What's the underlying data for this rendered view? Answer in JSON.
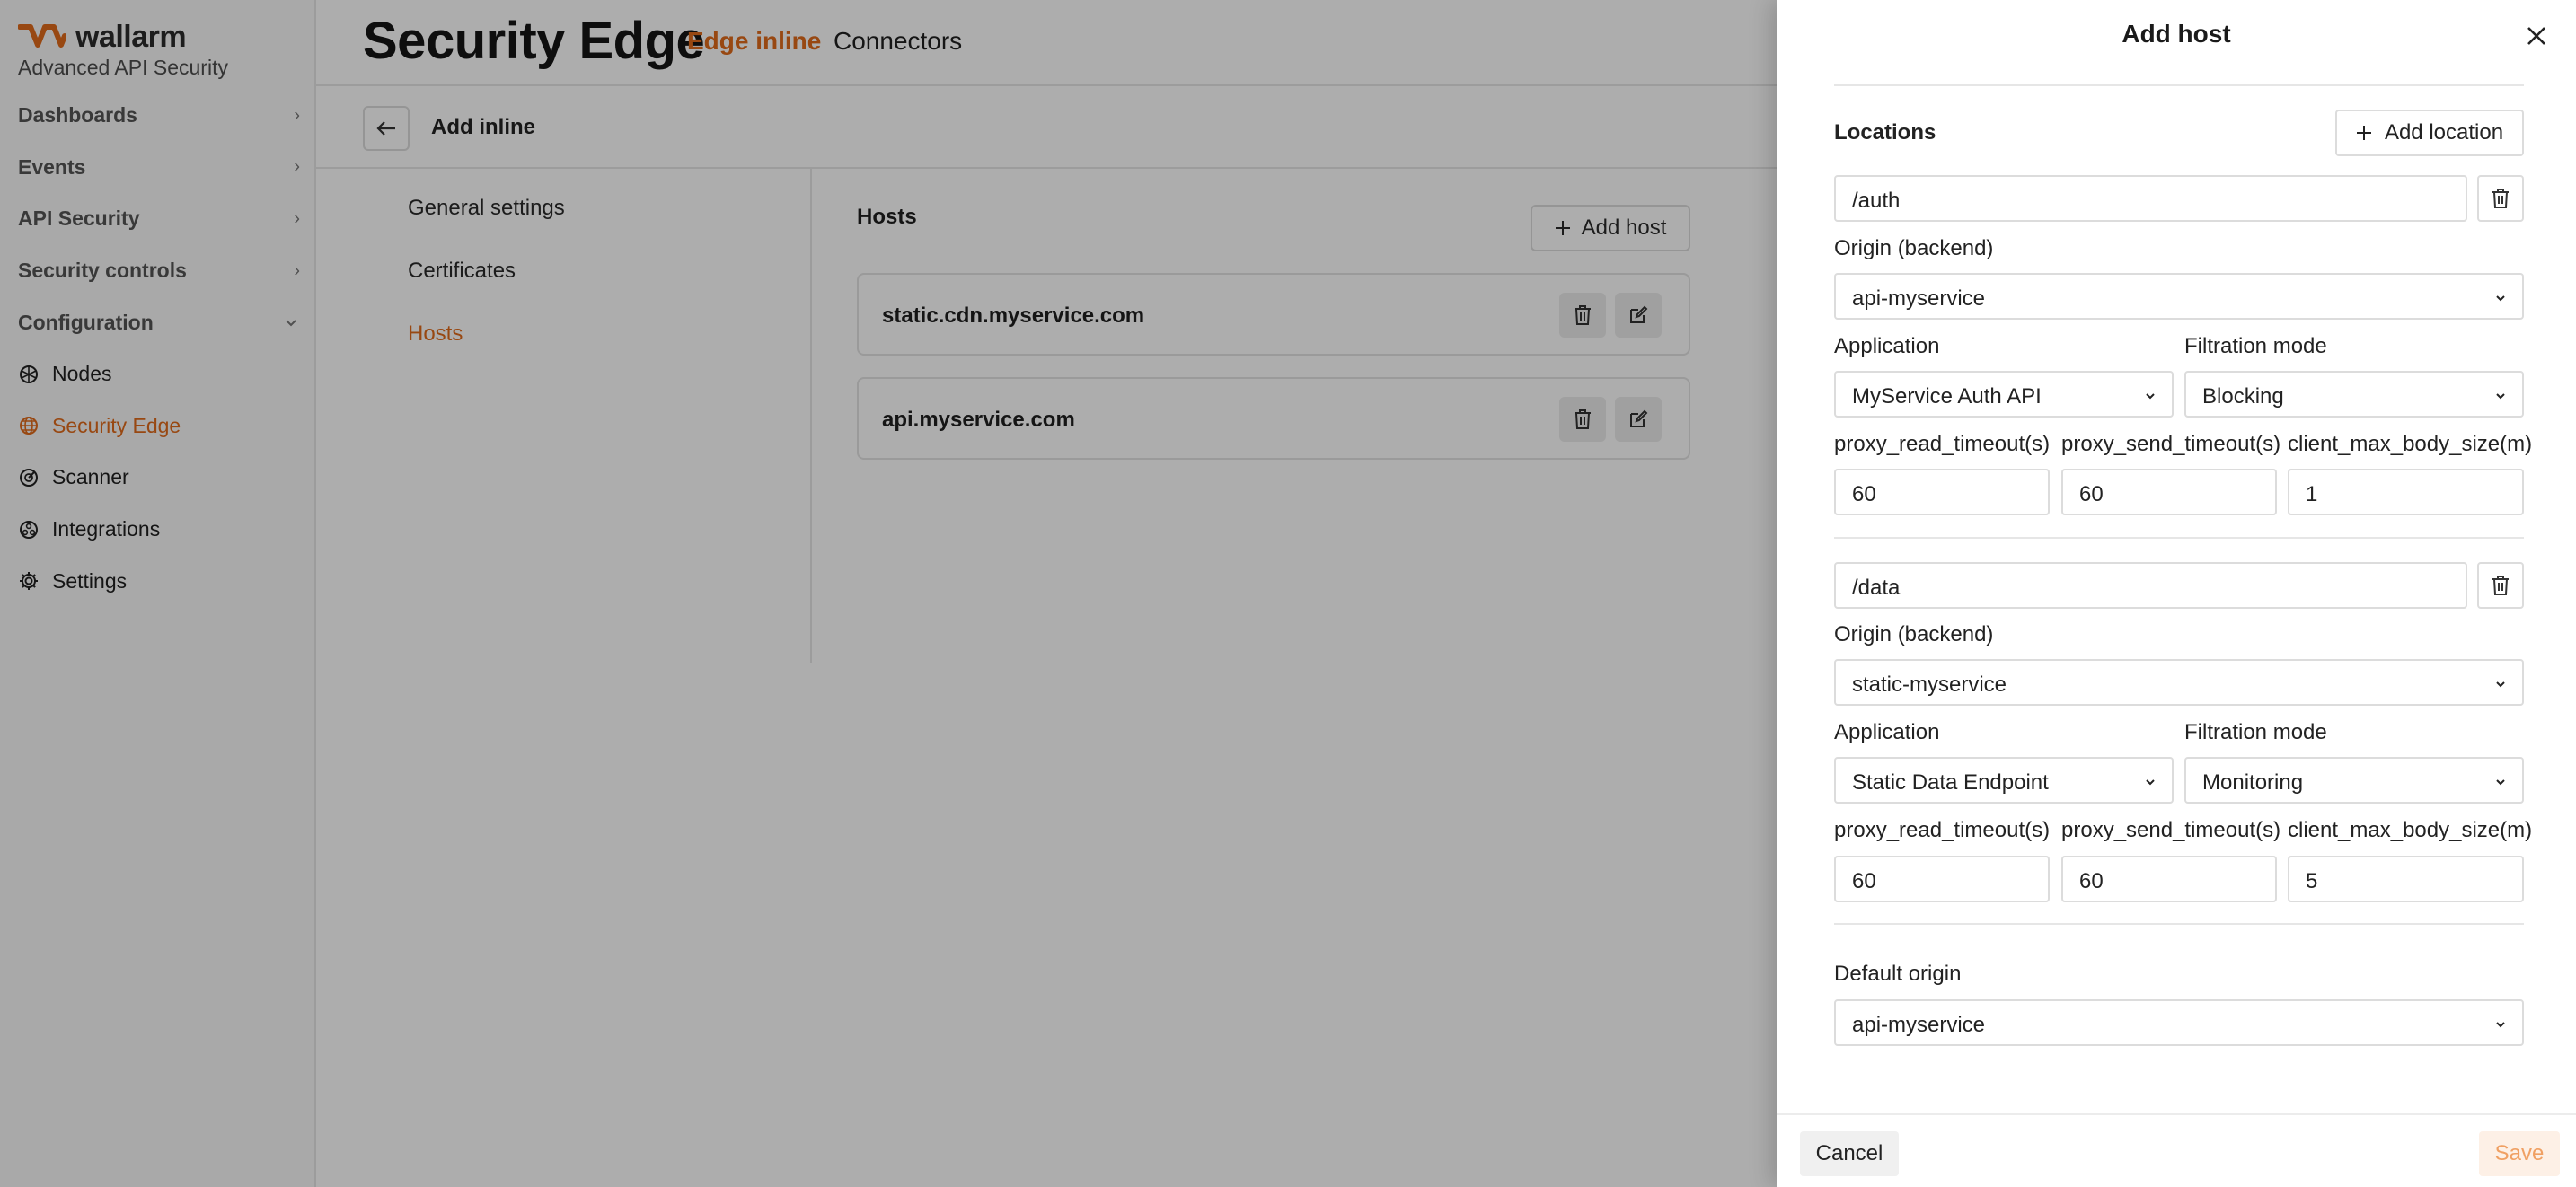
{
  "brand": {
    "name": "wallarm",
    "subtitle": "Advanced API Security",
    "accent": "#e06a1b"
  },
  "sidebar": {
    "items": [
      {
        "label": "Dashboards",
        "expandable": true
      },
      {
        "label": "Events",
        "expandable": true
      },
      {
        "label": "API Security",
        "expandable": true
      },
      {
        "label": "Security controls",
        "expandable": true
      },
      {
        "label": "Configuration",
        "expanded": true
      }
    ],
    "sub_items": [
      {
        "label": "Nodes",
        "icon": "nodes-icon"
      },
      {
        "label": "Security Edge",
        "icon": "globe-icon",
        "active": true
      },
      {
        "label": "Scanner",
        "icon": "scanner-icon"
      },
      {
        "label": "Integrations",
        "icon": "integrations-icon"
      },
      {
        "label": "Settings",
        "icon": "gear-icon"
      }
    ]
  },
  "header": {
    "title": "Security Edge",
    "tabs": [
      "Edge inline",
      "Connectors"
    ],
    "active_tab": "Edge inline"
  },
  "subheader": {
    "title": "Add inline"
  },
  "settings_nav": {
    "items": [
      "General settings",
      "Certificates",
      "Hosts"
    ],
    "active": "Hosts"
  },
  "hosts": {
    "title": "Hosts",
    "add_label": "Add host",
    "items": [
      {
        "name": "static.cdn.myservice.com"
      },
      {
        "name": "api.myservice.com"
      }
    ]
  },
  "drawer": {
    "title": "Add host",
    "locations_label": "Locations",
    "add_location_label": "Add location",
    "labels": {
      "origin": "Origin (backend)",
      "application": "Application",
      "filtration_mode": "Filtration mode",
      "proxy_read": "proxy_read_timeout(s)",
      "proxy_send": "proxy_send_timeout(s)",
      "client_max": "client_max_body_size(m)",
      "default_origin": "Default origin"
    },
    "locations": [
      {
        "path": "/auth",
        "origin": "api-myservice",
        "application": "MyService Auth API",
        "filtration_mode": "Blocking",
        "proxy_read_timeout": "60",
        "proxy_send_timeout": "60",
        "client_max_body_size": "1"
      },
      {
        "path": "/data",
        "origin": "static-myservice",
        "application": "Static Data Endpoint",
        "filtration_mode": "Monitoring",
        "proxy_read_timeout": "60",
        "proxy_send_timeout": "60",
        "client_max_body_size": "5"
      }
    ],
    "default_origin": "api-myservice",
    "cancel_label": "Cancel",
    "save_label": "Save"
  }
}
